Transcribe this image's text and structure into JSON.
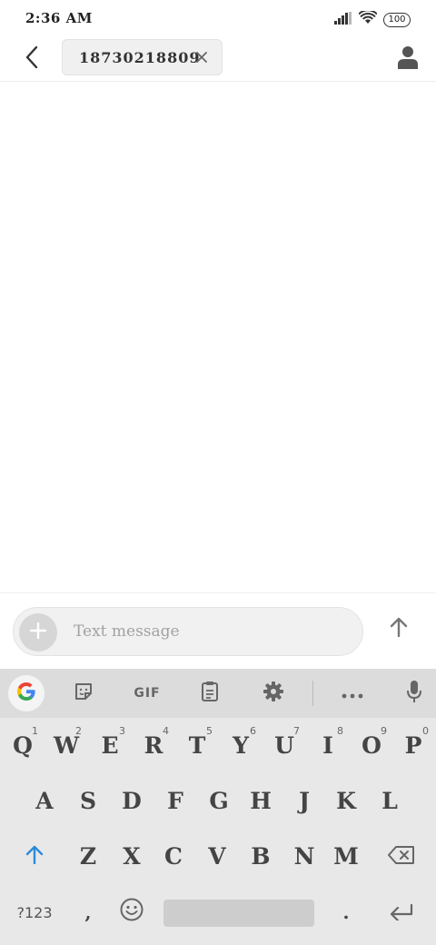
{
  "status_bar": {
    "time": "2:36 AM",
    "battery_level": "100"
  },
  "header": {
    "recipient": "18730218809"
  },
  "compose": {
    "placeholder": "Text message"
  },
  "keyboard": {
    "toolbar": {
      "gif_label": "GIF"
    },
    "row1": [
      {
        "label": "Q",
        "hint": "1"
      },
      {
        "label": "W",
        "hint": "2"
      },
      {
        "label": "E",
        "hint": "3"
      },
      {
        "label": "R",
        "hint": "4"
      },
      {
        "label": "T",
        "hint": "5"
      },
      {
        "label": "Y",
        "hint": "6"
      },
      {
        "label": "U",
        "hint": "7"
      },
      {
        "label": "I",
        "hint": "8"
      },
      {
        "label": "O",
        "hint": "9"
      },
      {
        "label": "P",
        "hint": "0"
      }
    ],
    "row2": [
      "A",
      "S",
      "D",
      "F",
      "G",
      "H",
      "J",
      "K",
      "L"
    ],
    "row3": [
      "Z",
      "X",
      "C",
      "V",
      "B",
      "N",
      "M"
    ],
    "row4": {
      "symbols_label": "?123",
      "comma_label": ",",
      "period_label": "."
    }
  },
  "colors": {
    "accent": "#2b8bd8",
    "keyboard_bg": "#e8e8e8",
    "toolbar_bg": "#dcdcdc"
  }
}
